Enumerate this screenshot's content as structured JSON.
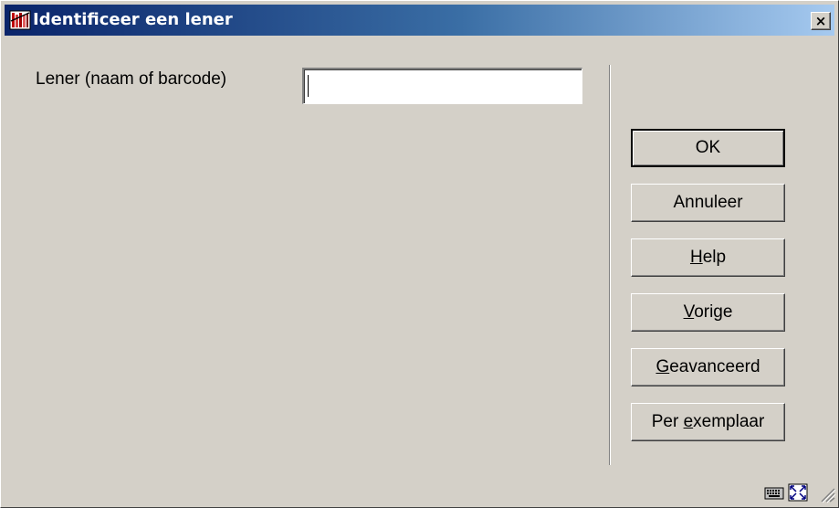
{
  "window": {
    "title": "Identificeer een lener"
  },
  "title_icon": "library-app-icon",
  "close_button": {
    "label": "×",
    "icon": "close-icon"
  },
  "form": {
    "borrower_label": "Lener (naam of barcode)",
    "borrower_value": ""
  },
  "buttons": [
    {
      "id": "ok",
      "label": "OK",
      "mnemonic_index": -1
    },
    {
      "id": "cancel",
      "label": "Annuleer",
      "mnemonic_index": -1
    },
    {
      "id": "help",
      "label": "Help",
      "mnemonic_index": 0
    },
    {
      "id": "previous",
      "label": "Vorige",
      "mnemonic_index": 0
    },
    {
      "id": "advanced",
      "label": "Geavanceerd",
      "mnemonic_index": 0
    },
    {
      "id": "per-copy",
      "label": "Per exemplaar",
      "mnemonic_index": 4
    }
  ],
  "status_icons": [
    "keyboard-icon",
    "maximize-icon",
    "resize-grip-icon"
  ],
  "colors": {
    "title_gradient_start": "#0a246a",
    "title_gradient_end": "#a6caf0",
    "face": "#d4d0c8"
  }
}
